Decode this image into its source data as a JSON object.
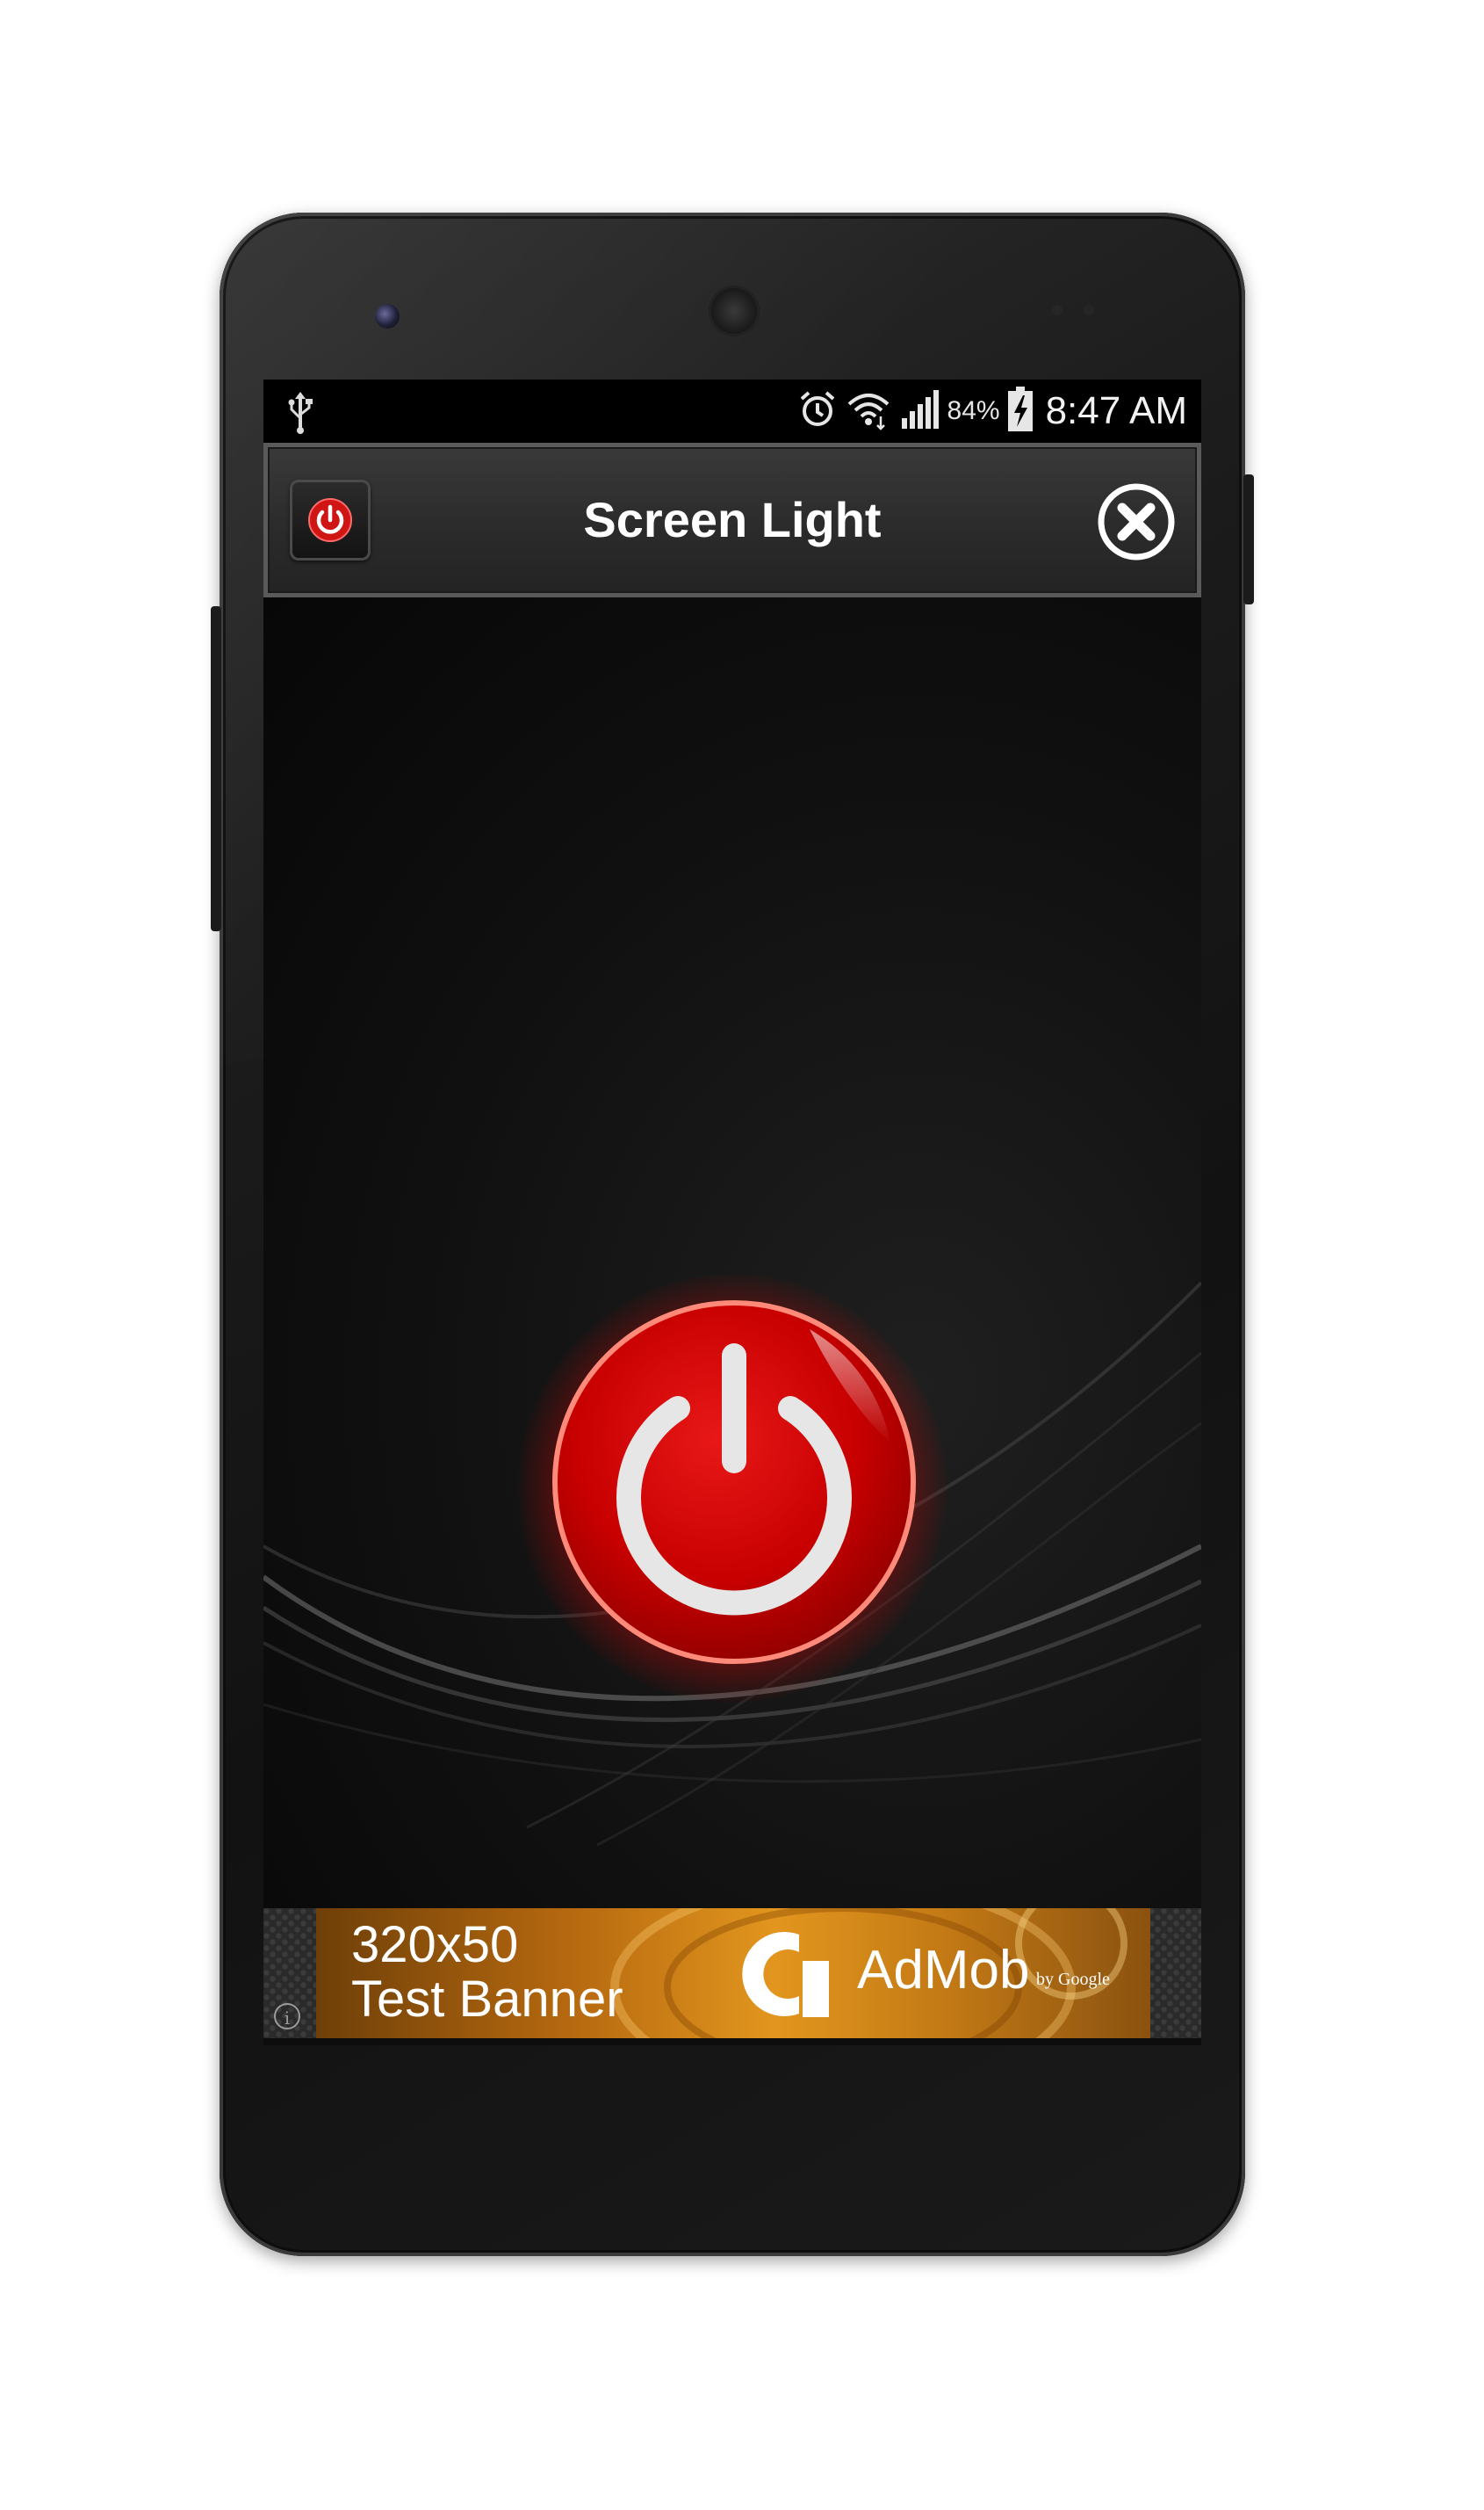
{
  "status_bar": {
    "battery_percent": "84%",
    "time": "8:47 AM",
    "icons": [
      "usb-icon",
      "alarm-icon",
      "wifi-icon",
      "signal-icon",
      "battery-charging-icon"
    ]
  },
  "app_bar": {
    "title": "Screen Light",
    "left_icon": "power-icon",
    "right_icon": "close-icon"
  },
  "main": {
    "power_button_icon": "power-icon",
    "power_button_color": "#d40000"
  },
  "ad": {
    "line1": "320x50",
    "line2": "Test Banner",
    "brand": "AdMob",
    "by": "by Google",
    "info_icon": "info-icon",
    "info_glyph": "i"
  },
  "colors": {
    "accent_red": "#d40000",
    "screen_bg": "#0d0d0d",
    "appbar_bg": "#2b2b2b",
    "ad_orange": "#e2961e"
  }
}
